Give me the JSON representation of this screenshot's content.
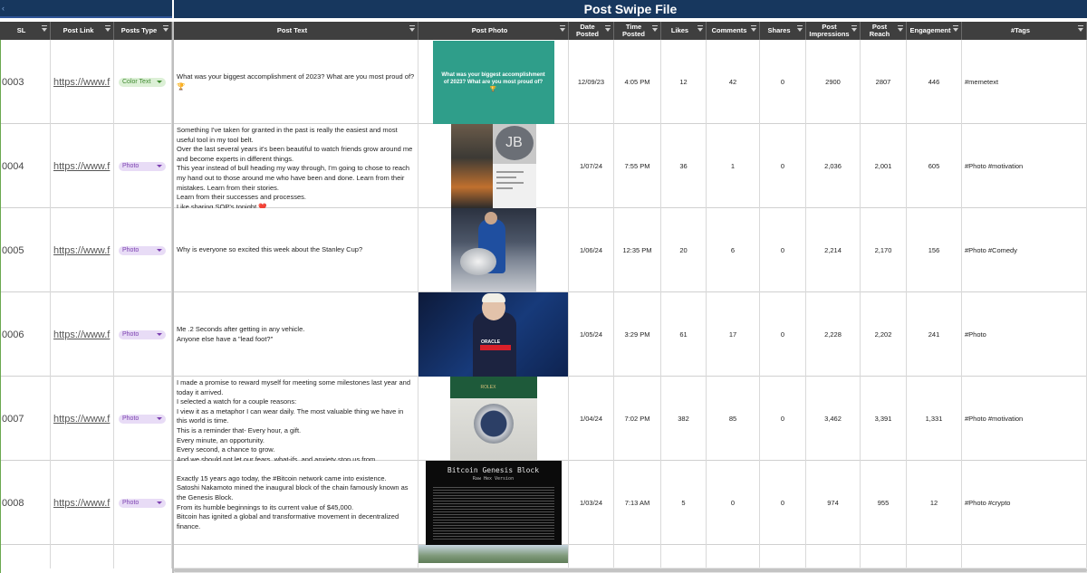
{
  "title": "Post Swipe File",
  "columns": {
    "sl": "SL",
    "post_link": "Post Link",
    "posts_type": "Posts Type",
    "post_text": "Post Text",
    "post_photo": "Post Photo",
    "date_posted": "Date Posted",
    "time_posted": "Time Posted",
    "likes": "Likes",
    "comments": "Comments",
    "shares": "Shares",
    "post_impressions": "Post Impressions",
    "post_reach": "Post Reach",
    "engagement": "Engagement",
    "tags": "#Tags"
  },
  "rows": [
    {
      "sl": "0003",
      "link": "https://www.f",
      "type": "Color Text",
      "text": "What was your biggest accomplishment of 2023? What are you most proud of? 🏆",
      "photo_caption": "What was your biggest accomplishment of 2023? What are you most proud of? 🏆",
      "date": "12/09/23",
      "time": "4:05 PM",
      "likes": "12",
      "comments": "42",
      "shares": "0",
      "impressions": "2900",
      "reach": "2807",
      "engagement": "446",
      "tags": "#memetext"
    },
    {
      "sl": "0004",
      "link": "https://www.f",
      "type": "Photo",
      "text": "Something I've taken for granted in the past is really the easiest and most useful tool in my tool belt.\nOver the last several years it's been beautiful to watch friends grow around me and become experts in different things.\nThis year instead of bull heading my way through, I'm going to chose to reach my hand out to those around me who have been and done. Learn from their mistakes. Learn from their stories.\nLearn from their successes and processes.\nLike sharing SOP's tonight ❤️",
      "photo_initials": "JB",
      "date": "1/07/24",
      "time": "7:55 PM",
      "likes": "36",
      "comments": "1",
      "shares": "0",
      "impressions": "2,036",
      "reach": "2,001",
      "engagement": "605",
      "tags": "#Photo #motivation"
    },
    {
      "sl": "0005",
      "link": "https://www.f",
      "type": "Photo",
      "text": "Why is everyone so excited this week about the Stanley Cup?",
      "date": "1/06/24",
      "time": "12:35 PM",
      "likes": "20",
      "comments": "6",
      "shares": "0",
      "impressions": "2,214",
      "reach": "2,170",
      "engagement": "156",
      "tags": "#Photo #Comedy"
    },
    {
      "sl": "0006",
      "link": "https://www.f",
      "type": "Photo",
      "text": "Me .2 Seconds after getting in any vehicle.\nAnyone else have a \"lead foot?\"",
      "photo_label": "ORACLE",
      "date": "1/05/24",
      "time": "3:29 PM",
      "likes": "61",
      "comments": "17",
      "shares": "0",
      "impressions": "2,228",
      "reach": "2,202",
      "engagement": "241",
      "tags": "#Photo"
    },
    {
      "sl": "0007",
      "link": "https://www.f",
      "type": "Photo",
      "text": "I made a promise to reward myself for meeting some milestones last year and today it arrived.\nI selected a watch for a couple reasons:\nI view it as a metaphor I can wear daily. The most valuable thing we have in this world is time.\nThis is a reminder that- Every hour, a gift.\nEvery minute, an opportunity.\nEvery second, a chance to grow.\nAnd we should not let our fears, what-ifs, and anxiety stop us from",
      "photo_label": "ROLEX",
      "date": "1/04/24",
      "time": "7:02 PM",
      "likes": "382",
      "comments": "85",
      "shares": "0",
      "impressions": "3,462",
      "reach": "3,391",
      "engagement": "1,331",
      "tags": "#Photo #motivation"
    },
    {
      "sl": "0008",
      "link": "https://www.f",
      "type": "Photo",
      "text": "Exactly 15 years ago today, the #Bitcoin network came into existence.\nSatoshi Nakamoto mined the inaugural block of the chain famously known as the Genesis Block.\nFrom its humble beginnings to its current value of $45,000.\nBitcoin has ignited a global and transformative movement in decentralized finance.",
      "photo_title": "Bitcoin Genesis Block",
      "photo_subtitle": "Raw Hex Version",
      "date": "1/03/24",
      "time": "7:13 AM",
      "likes": "5",
      "comments": "0",
      "shares": "0",
      "impressions": "974",
      "reach": "955",
      "engagement": "12",
      "tags": "#Photo #crypto"
    }
  ],
  "colors": {
    "title_band": "#17375e",
    "header": "#3f3f3f",
    "chip_photo": "#e8dcf6",
    "chip_color_text": "#dcf0d6",
    "teal_card": "#2f9e8a"
  }
}
